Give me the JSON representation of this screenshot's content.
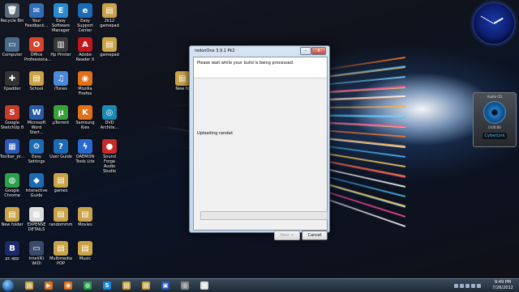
{
  "desktop": {
    "icons": [
      {
        "label": "Recycle Bin",
        "glyph": "🗑",
        "color": "#5a6a78"
      },
      {
        "label": "Your\nFeedback...",
        "glyph": "✉",
        "color": "#2f6db6"
      },
      {
        "label": "Easy Software\nManager",
        "glyph": "E",
        "color": "#2a8ad4"
      },
      {
        "label": "Easy Support\nCenter",
        "glyph": "e",
        "color": "#1b6ab5"
      },
      {
        "label": "2k12\ngamepad",
        "glyph": "▤",
        "color": "#c9a34a"
      },
      {
        "label": "Computer",
        "glyph": "▭",
        "color": "#4a6a8a"
      },
      {
        "label": "Office\nProfessiona...",
        "glyph": "O",
        "color": "#d8432b"
      },
      {
        "label": "Hp Printer",
        "glyph": "▥",
        "color": "#3a3a3a"
      },
      {
        "label": "Adobe\nReader X",
        "glyph": "A",
        "color": "#c0161c"
      },
      {
        "label": "gamepad",
        "glyph": "▤",
        "color": "#c9a34a"
      },
      {
        "label": "Xpadder",
        "glyph": "✚",
        "color": "#333"
      },
      {
        "label": "School",
        "glyph": "▤",
        "color": "#c9a34a"
      },
      {
        "label": "iTunes",
        "glyph": "♫",
        "color": "#4a8ad8"
      },
      {
        "label": "Mozilla\nFirefox",
        "glyph": "◉",
        "color": "#e0701a"
      },
      {
        "label": "Google\nSketchUp 8",
        "glyph": "S",
        "color": "#c83a2a"
      },
      {
        "label": "Microsoft\nWord Start...",
        "glyph": "W",
        "color": "#2a5aa8"
      },
      {
        "label": "µTorrent",
        "glyph": "µ",
        "color": "#3aa03a"
      },
      {
        "label": "Samsung\nKies",
        "glyph": "K",
        "color": "#e0701a"
      },
      {
        "label": "DVD\nArchite...",
        "glyph": "◎",
        "color": "#1a8ab5"
      },
      {
        "label": "Toolbar_pr...",
        "glyph": "▦",
        "color": "#2a5ab8"
      },
      {
        "label": "Easy Settings",
        "glyph": "⚙",
        "color": "#1b6ab5"
      },
      {
        "label": "User Guide",
        "glyph": "?",
        "color": "#1b6ab5"
      },
      {
        "label": "DAEMON\nTools Lite",
        "glyph": "ϟ",
        "color": "#2a6ad0"
      },
      {
        "label": "Sound Forge\nAudio Studio",
        "glyph": "●",
        "color": "#c82a2a"
      },
      {
        "label": "Google\nChrome",
        "glyph": "◍",
        "color": "#2aa04a"
      },
      {
        "label": "Interactive\nGuide",
        "glyph": "◆",
        "color": "#1b6ab5"
      },
      {
        "label": "games",
        "glyph": "▤",
        "color": "#c9a34a"
      },
      {
        "label": "New folder",
        "glyph": "▤",
        "color": "#c9a34a"
      },
      {
        "label": "EXPENSE\nDETAILS",
        "glyph": "▦",
        "color": "#ddd"
      },
      {
        "label": "randommm",
        "glyph": "▤",
        "color": "#c9a34a"
      },
      {
        "label": "Movies",
        "glyph": "▤",
        "color": "#c9a34a"
      },
      {
        "label": "pc app",
        "glyph": "B",
        "color": "#1a2a6a"
      },
      {
        "label": "Intel(R) WiDi",
        "glyph": "▭",
        "color": "#3a4a6a"
      },
      {
        "label": "Multimedia\nPOP",
        "glyph": "▤",
        "color": "#c9a34a"
      },
      {
        "label": "Music",
        "glyph": "▤",
        "color": "#c9a34a"
      },
      {
        "label": "New fo",
        "glyph": "▤",
        "color": "#c9a34a"
      }
    ]
  },
  "gadgets": {
    "media_title": "Audio CD",
    "media_time": "0:00:00",
    "media_brand": "CyberLink"
  },
  "dialog": {
    "title": "redonOne 3.9.1 Pk2",
    "message": "Please wait while your build is being processed.",
    "status": "Uploading randak",
    "progress": 0,
    "next_label": "Next >",
    "cancel_label": "Cancel",
    "minimize": "-",
    "close": "x"
  },
  "taskbar": {
    "time": "9:49 PM",
    "date": "7/26/2012",
    "pinned": [
      {
        "name": "explorer",
        "glyph": "▤",
        "color": "#c9a34a"
      },
      {
        "name": "media-player",
        "glyph": "▶",
        "color": "#e0701a"
      },
      {
        "name": "firefox",
        "glyph": "◉",
        "color": "#e0701a"
      },
      {
        "name": "chrome",
        "glyph": "◍",
        "color": "#2aa04a"
      },
      {
        "name": "skype",
        "glyph": "S",
        "color": "#1a8ad8"
      },
      {
        "name": "folder",
        "glyph": "▤",
        "color": "#c9a34a"
      },
      {
        "name": "folder-2",
        "glyph": "▤",
        "color": "#c9a34a"
      },
      {
        "name": "app",
        "glyph": "▣",
        "color": "#2a5ab8"
      },
      {
        "name": "app-2",
        "glyph": "◎",
        "color": "#888"
      },
      {
        "name": "document",
        "glyph": "▥",
        "color": "#ddd"
      }
    ]
  }
}
